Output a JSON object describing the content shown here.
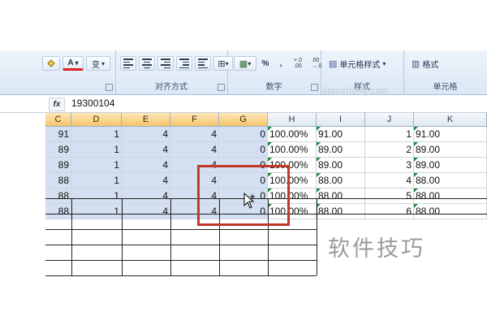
{
  "ribbon": {
    "font_group": {
      "fill_icon": "paint-bucket-icon",
      "font_color_label": "A",
      "phonetic_label": "变",
      "dropdown_arrow": "▾"
    },
    "alignment_group": {
      "label": "对齐方式"
    },
    "number_group": {
      "label": "数字",
      "percent_label": "%",
      "comma_label": ",",
      "increase_decimal_label": "+.0\n.00",
      "decrease_decimal_label": ".00\n→.0"
    },
    "styles_group": {
      "cell_styles_label": "单元格样式",
      "label": "样式"
    },
    "cells_group": {
      "format_label": "格式",
      "label": "单元格"
    },
    "watermark": "jitenzhong.com"
  },
  "formula_bar": {
    "fx_label": "fx",
    "value": "19300104"
  },
  "columns": [
    {
      "id": "c",
      "label": "C",
      "selected": true
    },
    {
      "id": "d",
      "label": "D",
      "selected": true
    },
    {
      "id": "e",
      "label": "E",
      "selected": true
    },
    {
      "id": "f",
      "label": "F",
      "selected": true
    },
    {
      "id": "g",
      "label": "G",
      "selected": true
    },
    {
      "id": "h",
      "label": "H",
      "selected": false
    },
    {
      "id": "i",
      "label": "I",
      "selected": false
    },
    {
      "id": "j",
      "label": "J",
      "selected": false
    },
    {
      "id": "k",
      "label": "K",
      "selected": false
    }
  ],
  "rows": [
    [
      "91",
      "1",
      "4",
      "4",
      "0",
      "100.00%",
      "91.00",
      "1",
      "91.00"
    ],
    [
      "89",
      "1",
      "4",
      "4",
      "0",
      "100.00%",
      "89.00",
      "2",
      "89.00"
    ],
    [
      "89",
      "1",
      "4",
      "4",
      "0",
      "100.00%",
      "89.00",
      "3",
      "89.00"
    ],
    [
      "88",
      "1",
      "4",
      "4",
      "0",
      "100.00%",
      "88.00",
      "4",
      "88.00"
    ],
    [
      "88",
      "1",
      "4",
      "4",
      "0",
      "100.00%",
      "88.00",
      "5",
      "88.00"
    ],
    [
      "88",
      "1",
      "4",
      "4",
      "0",
      "100.00%",
      "88.00",
      "6",
      "88.00"
    ]
  ],
  "caption": "软件技巧",
  "colors": {
    "selection": "#d4e0f1",
    "highlight_box": "#c0392b",
    "selected_header": "#f7c56c"
  }
}
